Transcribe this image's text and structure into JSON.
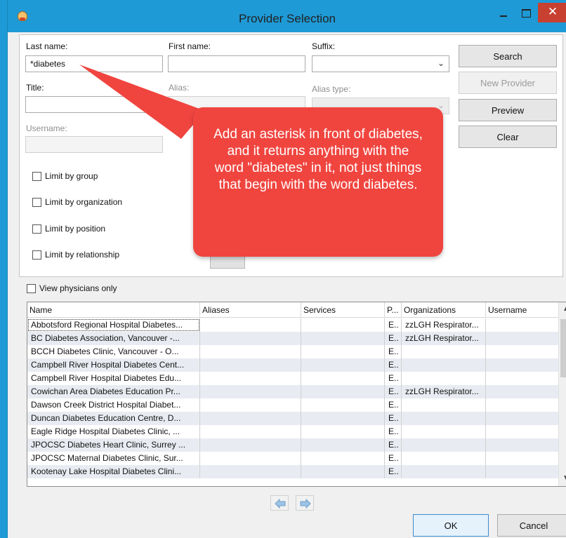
{
  "window": {
    "title": "Provider Selection",
    "close_glyph": "✕"
  },
  "form": {
    "last_name_label": "Last name:",
    "last_name_value": "*diabetes",
    "first_name_label": "First name:",
    "first_name_value": "",
    "suffix_label": "Suffix:",
    "title_label": "Title:",
    "alias_label": "Alias:",
    "alias_type_label": "Alias type:",
    "username_label": "Username:",
    "limit_group": "Limit by group",
    "limit_org": "Limit by organization",
    "limit_position": "Limit by position",
    "limit_relationship": "Limit by relationship"
  },
  "buttons": {
    "search": "Search",
    "new_provider": "New Provider",
    "preview": "Preview",
    "clear": "Clear",
    "ok": "OK",
    "cancel": "Cancel"
  },
  "callout": {
    "text": "Add an asterisk in front of diabetes, and it returns anything with the word \"diabetes\" in it, not just things that begin with the word diabetes.",
    "color": "#f0453f"
  },
  "view_physicians_only": "View physicians only",
  "grid": {
    "columns": [
      "Name",
      "Aliases",
      "Services",
      "P...",
      "Organizations",
      "Username"
    ],
    "rows": [
      {
        "name": "Abbotsford Regional Hospital Diabetes...",
        "p": "E..",
        "org": "zzLGH Respirator..."
      },
      {
        "name": "BC Diabetes Association, Vancouver -...",
        "p": "E..",
        "org": "zzLGH Respirator..."
      },
      {
        "name": "BCCH Diabetes Clinic, Vancouver - O...",
        "p": "E..",
        "org": ""
      },
      {
        "name": "Campbell River Hospital Diabetes Cent...",
        "p": "E..",
        "org": ""
      },
      {
        "name": "Campbell River Hospital Diabetes Edu...",
        "p": "E..",
        "org": ""
      },
      {
        "name": "Cowichan Area Diabetes Education Pr...",
        "p": "E..",
        "org": "zzLGH Respirator..."
      },
      {
        "name": "Dawson Creek District Hospital Diabet...",
        "p": "E..",
        "org": ""
      },
      {
        "name": "Duncan Diabetes Education Centre, D...",
        "p": "E..",
        "org": ""
      },
      {
        "name": "Eagle Ridge Hospital Diabetes Clinic, ...",
        "p": "E..",
        "org": ""
      },
      {
        "name": "JPOCSC Diabetes Heart Clinic, Surrey ...",
        "p": "E..",
        "org": ""
      },
      {
        "name": "JPOCSC Maternal Diabetes Clinic, Sur...",
        "p": "E..",
        "org": ""
      },
      {
        "name": "Kootenay Lake Hospital Diabetes Clini...",
        "p": "E..",
        "org": ""
      }
    ]
  },
  "colors": {
    "titlebar": "#1e9ad6",
    "close_button": "#c84030",
    "alt_row": "#e8ecf2"
  }
}
